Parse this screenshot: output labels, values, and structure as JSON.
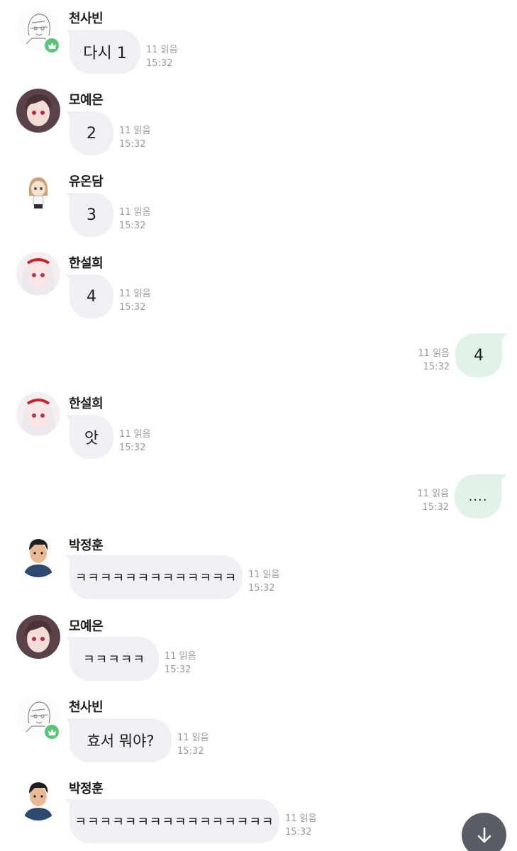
{
  "read_label": "11 읽음",
  "time": "15:32",
  "messages": [
    {
      "sender": "천사빈",
      "text": "다시 1"
    },
    {
      "sender": "모예은",
      "text": "2"
    },
    {
      "sender": "유온담",
      "text": "3"
    },
    {
      "sender": "한설희",
      "text": "4"
    },
    {
      "sender": "",
      "text": "4"
    },
    {
      "sender": "한설희",
      "text": "앗"
    },
    {
      "sender": "",
      "text": "...."
    },
    {
      "sender": "박정훈",
      "text": "ㅋㅋㅋㅋㅋㅋㅋㅋㅋㅋㅋㅋㅋ"
    },
    {
      "sender": "모예은",
      "text": "ㅋㅋㅋㅋㅋ"
    },
    {
      "sender": "천사빈",
      "text": "효서 뭐야?"
    },
    {
      "sender": "박정훈",
      "text": "ㅋㅋㅋㅋㅋㅋㅋㅋㅋㅋㅋㅋㅋㅋㅋㅋ"
    }
  ],
  "colors": {
    "incoming_bubble": "#eef0f3",
    "outgoing_bubble": "#e1f3e8",
    "crown_badge": "#5fc27a",
    "scroll_button": "#5a5d63"
  },
  "icons": {
    "crown": "crown-icon",
    "scroll_down": "arrow-down-icon"
  }
}
